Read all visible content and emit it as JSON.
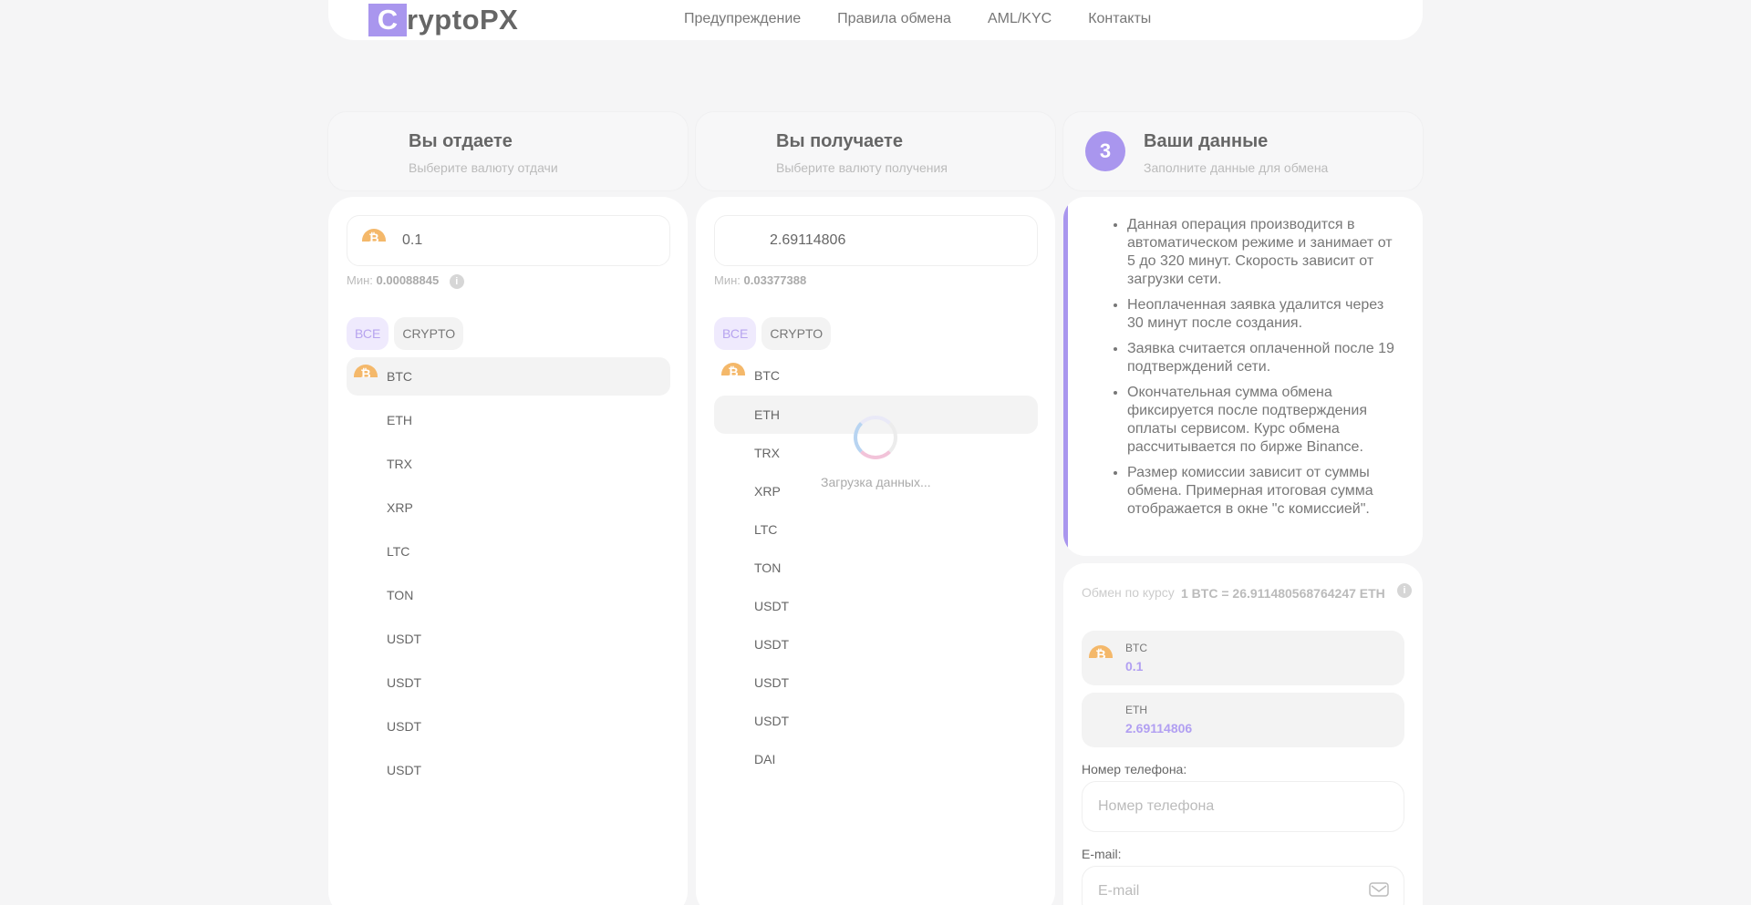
{
  "header": {
    "logo_letter": "C",
    "logo_text": "ryptoPX",
    "nav": [
      "Предупреждение",
      "Правила обмена",
      "AML/KYC",
      "Контакты"
    ]
  },
  "steps": [
    {
      "title": "Вы отдаете",
      "subtitle": "Выберите валюту отдачи"
    },
    {
      "title": "Вы получаете",
      "subtitle": "Выберите валюту получения"
    },
    {
      "number": "3",
      "title": "Ваши данные",
      "subtitle": "Заполните данные для обмена"
    }
  ],
  "give": {
    "amount": "0.1",
    "min_label": "Мин:",
    "min_value": "0.00088845",
    "filters": [
      "ВСЕ",
      "CRYPTO"
    ],
    "currencies": [
      "BTC",
      "ETH",
      "TRX",
      "XRP",
      "LTC",
      "TON",
      "USDT",
      "USDT",
      "USDT",
      "USDT"
    ]
  },
  "receive": {
    "amount": "2.69114806",
    "min_label": "Мин:",
    "min_value": "0.03377388",
    "filters": [
      "ВСЕ",
      "CRYPTO"
    ],
    "currencies": [
      "BTC",
      "ETH",
      "TRX",
      "XRP",
      "LTC",
      "TON",
      "USDT",
      "USDT",
      "USDT",
      "USDT",
      "DAI"
    ],
    "loading_text": "Загрузка данных..."
  },
  "rules": [
    "Данная операция производится в автоматическом режиме и занимает от 5 до 320 минут. Скорость зависит от загрузки сети.",
    "Неоплаченная заявка удалится через 30 минут после создания.",
    "Заявка считается оплаченной после 19 подтверждений сети.",
    "Окончательная сумма обмена фиксируется после подтверждения оплаты сервисом. Курс обмена рассчитывается по бирже Binance.",
    "Размер комиссии зависит от суммы обмена. Примерная итоговая сумма отображается в окне \"с комиссией\"."
  ],
  "form": {
    "rate_label": "Обмен по курсу",
    "rate_value": "1 BTC = 26.911480568764247 ETH",
    "give_code": "BTC",
    "give_value": "0.1",
    "get_code": "ETH",
    "get_value": "2.69114806",
    "phone_label": "Номер телефона:",
    "phone_placeholder": "Номер телефона",
    "email_label": "E-mail:",
    "email_placeholder": "E-mail"
  },
  "colors": {
    "accent": "#a996ee",
    "btc": "#f4b86a",
    "background": "#f5f5f6"
  }
}
